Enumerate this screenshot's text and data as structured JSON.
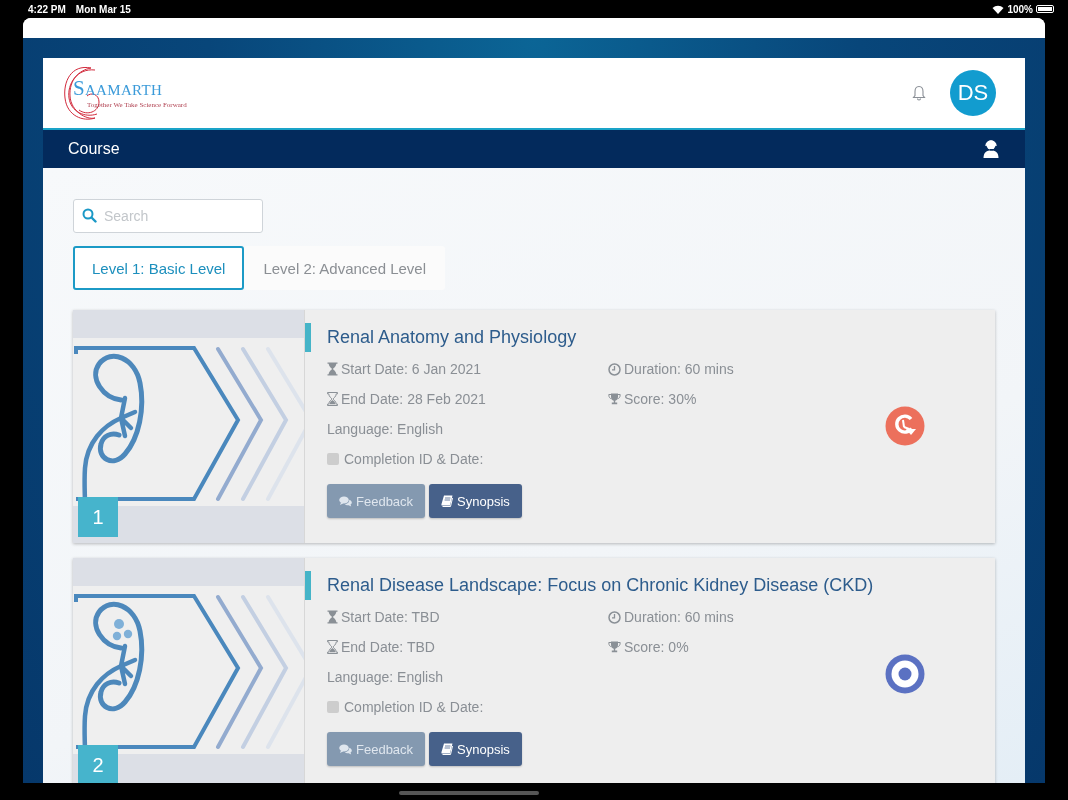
{
  "status_bar": {
    "time": "4:22 PM",
    "date": "Mon Mar 15",
    "battery": "100%"
  },
  "header": {
    "logo": "SAAMARTH",
    "tagline": "Together We Take Science Forward",
    "avatar": "DS"
  },
  "nav": {
    "title": "Course"
  },
  "search": {
    "placeholder": "Search"
  },
  "tabs": [
    {
      "label": "Level 1: Basic Level",
      "selected": true
    },
    {
      "label": "Level 2: Advanced Level",
      "selected": false
    }
  ],
  "courses": [
    {
      "number": "1",
      "title": "Renal Anatomy and Physiology",
      "start": "Start Date: 6 Jan 2021",
      "end": "End Date: 28 Feb 2021",
      "duration": "Duration: 60 mins",
      "score": "Score: 30%",
      "language": "Language: English",
      "completion": {
        "label": "Completion ID & Date:",
        "checked": false
      },
      "kind": "retake",
      "stones": false,
      "buttons": [
        {
          "label": "Feedback",
          "kind": "feedback",
          "disabled": true
        },
        {
          "label": "Synopsis",
          "kind": "synopsis",
          "disabled": false
        }
      ]
    },
    {
      "number": "2",
      "title": "Renal Disease Landscape: Focus on Chronic Kidney Disease (CKD)",
      "start": "Start Date: TBD",
      "end": "End Date: TBD",
      "duration": "Duration: 60 mins",
      "score": "Score: 0%",
      "language": "Language: English",
      "completion": {
        "label": "Completion ID & Date:",
        "checked": false
      },
      "kind": "pending",
      "stones": true,
      "buttons": [
        {
          "label": "Feedback",
          "kind": "feedback",
          "disabled": true
        },
        {
          "label": "Synopsis",
          "kind": "synopsis",
          "disabled": false
        }
      ]
    }
  ]
}
